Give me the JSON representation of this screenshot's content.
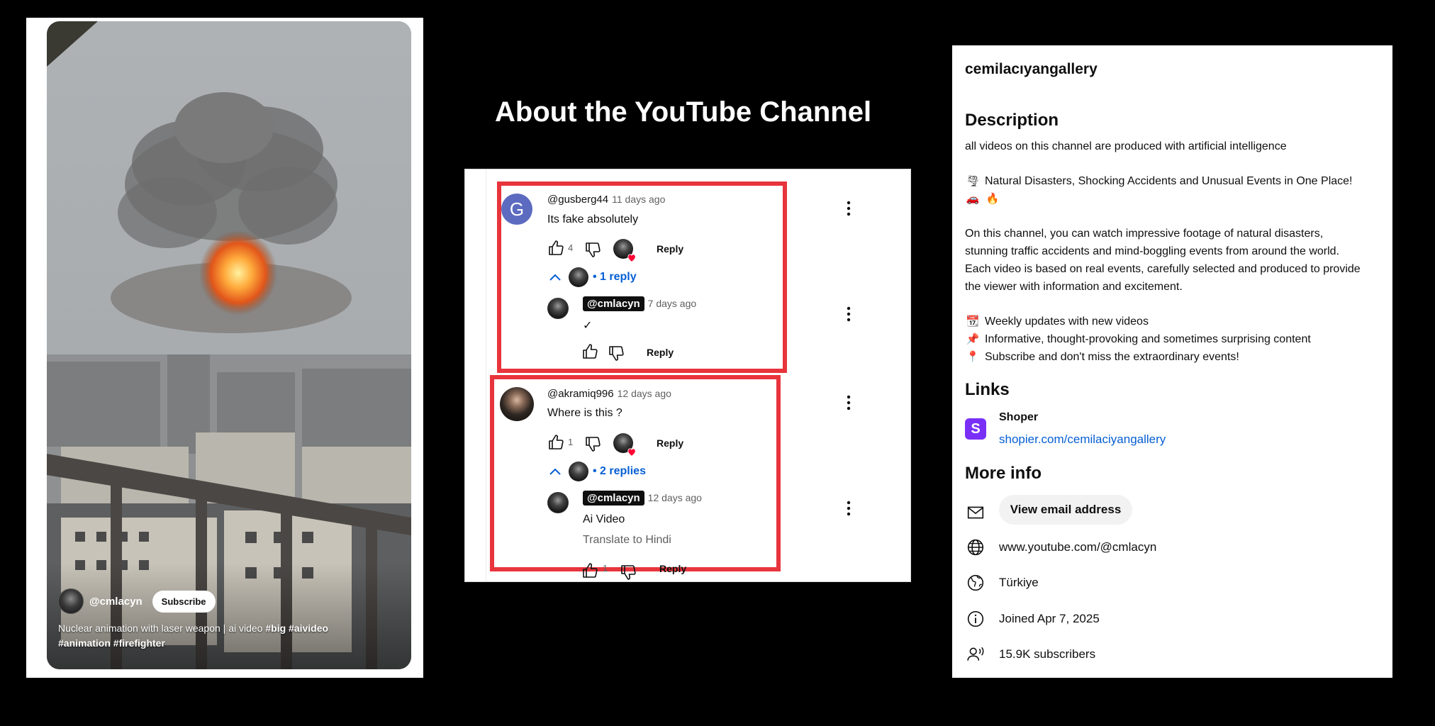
{
  "video": {
    "handle": "@cmlacyn",
    "subscribe_label": "Subscribe",
    "caption_prefix": "Nuclear animation with laser weapon | ai video",
    "hashtags": [
      "#big",
      "#aivideo",
      "#animation",
      "#firefighter"
    ]
  },
  "middle": {
    "title": "About the YouTube Channel"
  },
  "comments": [
    {
      "author": "@gusberg44",
      "avatar_letter": "G",
      "time": "11 days ago",
      "text": "Its fake absolutely",
      "likes": "4",
      "reply_label": "Reply",
      "replies_link": "1 reply",
      "reply": {
        "author": "@cmlacyn",
        "time": "7 days ago",
        "text": "✓",
        "reply_label": "Reply"
      }
    },
    {
      "author": "@akramiq996",
      "time": "12 days ago",
      "text": "Where is this ?",
      "likes": "1",
      "reply_label": "Reply",
      "replies_link": "2 replies",
      "reply": {
        "author": "@cmlacyn",
        "time": "12 days ago",
        "text": "Ai Video",
        "translate": "Translate to Hindi",
        "likes": "1",
        "reply_label": "Reply"
      }
    }
  ],
  "about": {
    "channel": "cemilacıyangallery",
    "description_heading": "Description",
    "desc_line1": "all videos on this channel are produced with artificial intelligence",
    "desc_line2": "Natural Disasters, Shocking Accidents and Unusual Events in One Place!",
    "desc_para": [
      "On this channel, you can watch impressive footage of natural disasters,",
      "stunning traffic accidents and mind-boggling events from around the world.",
      "Each video is based on real events, carefully selected and produced to provide",
      "the viewer with information and excitement."
    ],
    "bullets": [
      "Weekly updates with new videos",
      "Informative, thought-provoking and sometimes surprising content",
      "Subscribe and don't miss the extraordinary events!"
    ],
    "emoji": {
      "tornado": "🌪",
      "car": "🚗",
      "fire": "🔥",
      "calendar": "📆",
      "pin": "📌",
      "location": "📍"
    },
    "links_heading": "Links",
    "link": {
      "logo_letter": "S",
      "name": "Shoper",
      "url": "shopier.com/cemilaciyangallery",
      "logo_color": "#7a2ff7"
    },
    "more_heading": "More info",
    "email_button": "View email address",
    "website": "www.youtube.com/@cmlacyn",
    "country": "Türkiye",
    "joined": "Joined Apr 7, 2025",
    "subscribers": "15.9K subscribers"
  },
  "colors": {
    "highlight": "#e8343c",
    "link_blue": "#065fd4"
  }
}
